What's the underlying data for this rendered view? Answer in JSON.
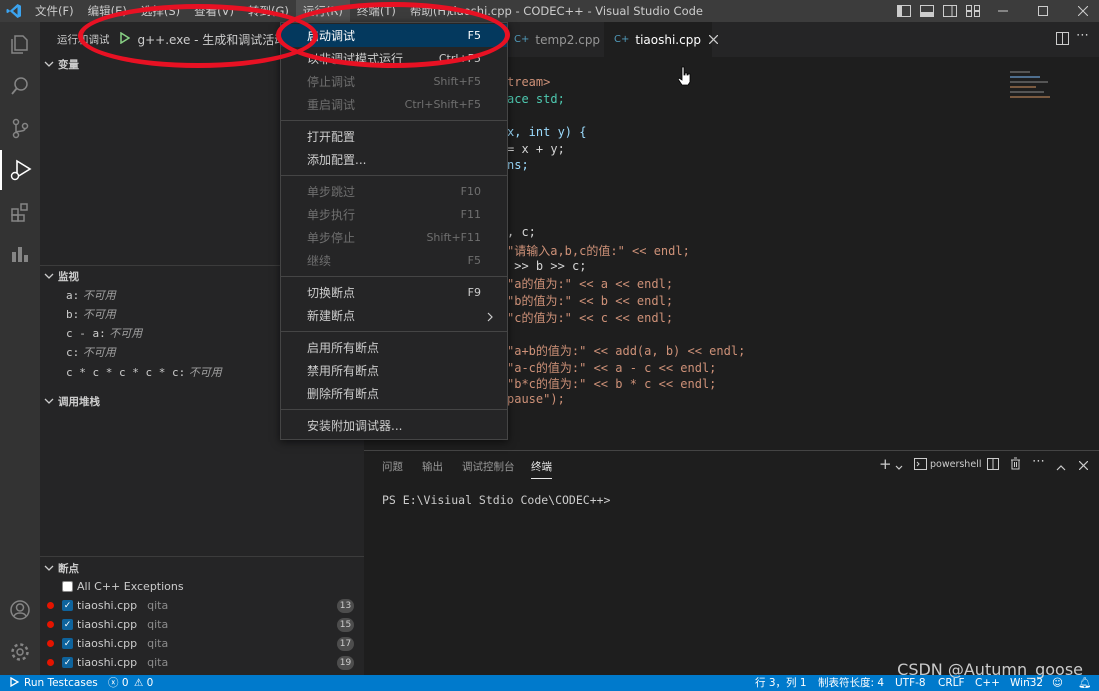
{
  "titlebar": {
    "menus": [
      "文件(F)",
      "编辑(E)",
      "选择(S)",
      "查看(V)",
      "转到(G)",
      "运行(R)",
      "终端(T)",
      "帮助(H)"
    ],
    "title": "tiaoshi.cpp - CODEC++ - Visual Studio Code"
  },
  "sidebar": {
    "run_label": "运行和调试",
    "config_name": "g++.exe - 生成和调试活动文",
    "variables_header": "变量",
    "watch_header": "监视",
    "watch": [
      {
        "expr": "a:",
        "value": "不可用"
      },
      {
        "expr": "b:",
        "value": "不可用"
      },
      {
        "expr": "c - a:",
        "value": "不可用"
      },
      {
        "expr": "c:",
        "value": "不可用"
      },
      {
        "expr": "c * c * c * c * c:",
        "value": "不可用"
      }
    ],
    "callstack_header": "调用堆栈",
    "breakpoints_header": "断点",
    "exceptions_label": "All C++ Exceptions",
    "breakpoints": [
      {
        "file": "tiaoshi.cpp",
        "folder": "qita",
        "line": "13"
      },
      {
        "file": "tiaoshi.cpp",
        "folder": "qita",
        "line": "15"
      },
      {
        "file": "tiaoshi.cpp",
        "folder": "qita",
        "line": "17"
      },
      {
        "file": "tiaoshi.cpp",
        "folder": "qita",
        "line": "19"
      }
    ]
  },
  "tabs": {
    "inactive": "temp2.cpp",
    "active": "tiaoshi.cpp"
  },
  "editor": {
    "lines": [
      "tream>",
      "ace std;",
      "",
      "x, int y) {",
      "= x + y;",
      "ns;",
      "",
      "",
      "",
      ", c;",
      "\"请输入a,b,c的值:\" << endl;",
      " >> b >> c;",
      "\"a的值为:\" << a << endl;",
      "\"b的值为:\" << b << endl;",
      "\"c的值为:\" << c << endl;",
      "",
      "\"a+b的值为:\" << add(a, b) << endl;",
      "\"a-c的值为:\" << a - c << endl;",
      "\"b*c的值为:\" << b * c << endl;",
      "pause\");"
    ]
  },
  "run_menu": {
    "items": [
      {
        "label": "启动调试",
        "key": "F5",
        "state": "selected"
      },
      {
        "label": "以非调试模式运行",
        "key": "Ctrl+F5",
        "state": "enabled"
      },
      {
        "label": "停止调试",
        "key": "Shift+F5",
        "state": "disabled"
      },
      {
        "label": "重启调试",
        "key": "Ctrl+Shift+F5",
        "state": "disabled"
      },
      {
        "label": "打开配置",
        "key": "",
        "state": "enabled"
      },
      {
        "label": "添加配置...",
        "key": "",
        "state": "enabled"
      },
      {
        "label": "单步跳过",
        "key": "F10",
        "state": "disabled"
      },
      {
        "label": "单步执行",
        "key": "F11",
        "state": "disabled"
      },
      {
        "label": "单步停止",
        "key": "Shift+F11",
        "state": "disabled"
      },
      {
        "label": "继续",
        "key": "F5",
        "state": "disabled"
      },
      {
        "label": "切换断点",
        "key": "F9",
        "state": "enabled"
      },
      {
        "label": "新建断点",
        "key": "",
        "state": "enabled"
      },
      {
        "label": "启用所有断点",
        "key": "",
        "state": "enabled"
      },
      {
        "label": "禁用所有断点",
        "key": "",
        "state": "enabled"
      },
      {
        "label": "删除所有断点",
        "key": "",
        "state": "enabled"
      },
      {
        "label": "安装附加调试器...",
        "key": "",
        "state": "enabled"
      }
    ]
  },
  "panel": {
    "tabs": [
      "问题",
      "输出",
      "调试控制台",
      "终端"
    ],
    "active_tab": "终端",
    "shell": "powershell",
    "prompt": "PS E:\\Visiual Stdio Code\\CODEC++> "
  },
  "statusbar": {
    "run_testcases": "Run Testcases",
    "errors": "0",
    "warnings": "0",
    "position": "行 3，列 1",
    "tab_size": "制表符长度: 4",
    "encoding": "UTF-8",
    "eol": "CRLF",
    "language": "C++",
    "platform": "Win32"
  },
  "watermark": "CSDN @Autumn_goose",
  "colors": {
    "accent": "#007acc",
    "breakpoint": "#e51400",
    "annotation": "#e81123"
  }
}
